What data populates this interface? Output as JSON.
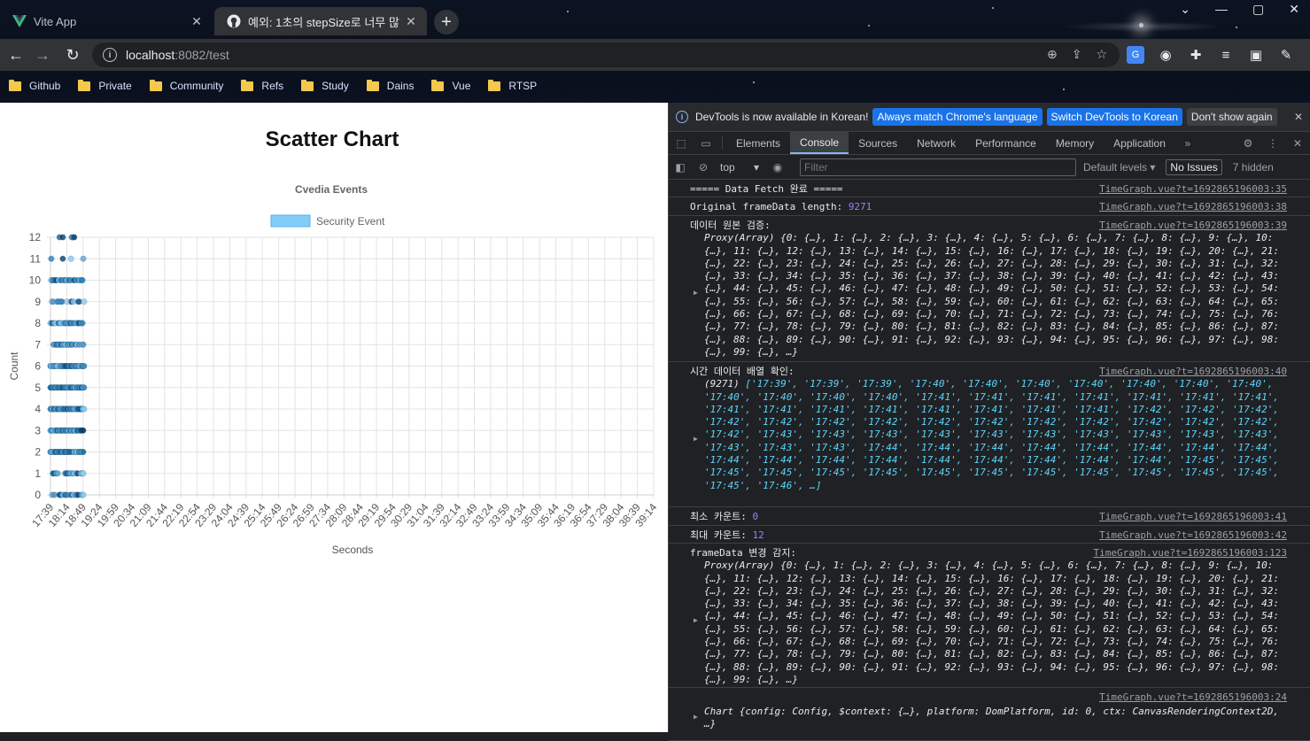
{
  "browser": {
    "tabs": [
      {
        "title": "Vite App",
        "icon": "vue-logo-icon",
        "active": false
      },
      {
        "title": "예외: 1초의 stepSize로 너무 많",
        "icon": "github-icon",
        "active": true
      }
    ],
    "new_tab": "+",
    "address": {
      "host": "localhost",
      "path": ":8082/test"
    },
    "bookmarks": [
      "Github",
      "Private",
      "Community",
      "Refs",
      "Study",
      "Dains",
      "Vue",
      "RTSP"
    ]
  },
  "page": {
    "title": "Scatter Chart"
  },
  "chart_data": {
    "type": "scatter",
    "title": "Cvedia Events",
    "xlabel": "Seconds",
    "ylabel": "Count",
    "legend": {
      "label": "Security Event",
      "color": "#82cdf7",
      "position": "top"
    },
    "ylim": [
      0,
      12
    ],
    "yticks": [
      "0",
      "1",
      "2",
      "3",
      "4",
      "5",
      "6",
      "7",
      "8",
      "9",
      "10",
      "11",
      "12"
    ],
    "xticks": [
      "17:39",
      "18:14",
      "18:49",
      "19:24",
      "19:59",
      "20:34",
      "21:09",
      "21:44",
      "22:19",
      "22:54",
      "23:29",
      "24:04",
      "24:39",
      "25:14",
      "25:49",
      "26:24",
      "26:59",
      "27:34",
      "28:09",
      "28:44",
      "29:19",
      "29:54",
      "30:29",
      "31:04",
      "31:39",
      "32:14",
      "32:49",
      "33:24",
      "33:59",
      "34:34",
      "35:09",
      "35:44",
      "36:19",
      "36:54",
      "37:29",
      "38:04",
      "38:39",
      "39:14"
    ],
    "x_range_seconds": [
      "17:39",
      "18:50"
    ],
    "series": [
      {
        "name": "Security Event",
        "y_values_present": [
          0,
          1,
          2,
          3,
          4,
          5,
          6,
          7,
          8,
          9,
          10,
          11,
          12
        ]
      }
    ],
    "grid": true
  },
  "devtools": {
    "infobar": {
      "text": "DevTools is now available in Korean!",
      "btn_match": "Always match Chrome's language",
      "btn_switch": "Switch DevTools to Korean",
      "btn_dismiss": "Don't show again"
    },
    "tabs": [
      "Elements",
      "Console",
      "Sources",
      "Network",
      "Performance",
      "Memory",
      "Application"
    ],
    "active_tab": "Console",
    "console_bar": {
      "context": "top",
      "filter_placeholder": "Filter",
      "levels": "Default levels ▾",
      "issues": "No Issues",
      "hidden": "7 hidden"
    },
    "messages": [
      {
        "text": "===== Data Fetch 완료 =====",
        "src": "TimeGraph.vue?t=1692865196003:35"
      },
      {
        "text": "Original frameData length: ",
        "num": "9271",
        "src": "TimeGraph.vue?t=1692865196003:38"
      },
      {
        "text": "데이터 원본 검증:",
        "src": "TimeGraph.vue?t=1692865196003:39",
        "obj": "Proxy(Array) {0: {…}, 1: {…}, 2: {…}, 3: {…}, 4: {…}, 5: {…}, 6: {…}, 7: {…}, 8: {…}, 9: {…}, 10: {…}, 11: {…}, 12: {…}, 13: {…}, 14: {…}, 15: {…}, 16: {…}, 17: {…}, 18: {…}, 19: {…}, 20: {…}, 21: {…}, 22: {…}, 23: {…}, 24: {…}, 25: {…}, 26: {…}, 27: {…}, 28: {…}, 29: {…}, 30: {…}, 31: {…}, 32: {…}, 33: {…}, 34: {…}, 35: {…}, 36: {…}, 37: {…}, 38: {…}, 39: {…}, 40: {…}, 41: {…}, 42: {…}, 43: {…}, 44: {…}, 45: {…}, 46: {…}, 47: {…}, 48: {…}, 49: {…}, 50: {…}, 51: {…}, 52: {…}, 53: {…}, 54: {…}, 55: {…}, 56: {…}, 57: {…}, 58: {…}, 59: {…}, 60: {…}, 61: {…}, 62: {…}, 63: {…}, 64: {…}, 65: {…}, 66: {…}, 67: {…}, 68: {…}, 69: {…}, 70: {…}, 71: {…}, 72: {…}, 73: {…}, 74: {…}, 75: {…}, 76: {…}, 77: {…}, 78: {…}, 79: {…}, 80: {…}, 81: {…}, 82: {…}, 83: {…}, 84: {…}, 85: {…}, 86: {…}, 87: {…}, 88: {…}, 89: {…}, 90: {…}, 91: {…}, 92: {…}, 93: {…}, 94: {…}, 95: {…}, 96: {…}, 97: {…}, 98: {…}, 99: {…}, …}"
      },
      {
        "text": "시간 데이터 배열 확인:",
        "src": "TimeGraph.vue?t=1692865196003:40",
        "lead": "(9271) ",
        "strs": "['17:39', '17:39', '17:39', '17:40', '17:40', '17:40', '17:40', '17:40', '17:40', '17:40', '17:40', '17:40', '17:40', '17:40', '17:41', '17:41', '17:41', '17:41', '17:41', '17:41', '17:41', '17:41', '17:41', '17:41', '17:41', '17:41', '17:41', '17:41', '17:41', '17:42', '17:42', '17:42', '17:42', '17:42', '17:42', '17:42', '17:42', '17:42', '17:42', '17:42', '17:42', '17:42', '17:42', '17:42', '17:43', '17:43', '17:43', '17:43', '17:43', '17:43', '17:43', '17:43', '17:43', '17:43', '17:43', '17:43', '17:43', '17:44', '17:44', '17:44', '17:44', '17:44', '17:44', '17:44', '17:44', '17:44', '17:44', '17:44', '17:44', '17:44', '17:44', '17:44', '17:44', '17:44', '17:45', '17:45', '17:45', '17:45', '17:45', '17:45', '17:45', '17:45', '17:45', '17:45', '17:45', '17:45', '17:45', '17:45', '17:46', …]"
      },
      {
        "text": "최소 카운트: ",
        "num": "0",
        "src": "TimeGraph.vue?t=1692865196003:41"
      },
      {
        "text": "최대 카운트: ",
        "num": "12",
        "src": "TimeGraph.vue?t=1692865196003:42"
      },
      {
        "text": "frameData 변경 감지:",
        "src": "TimeGraph.vue?t=1692865196003:123",
        "obj": "Proxy(Array) {0: {…}, 1: {…}, 2: {…}, 3: {…}, 4: {…}, 5: {…}, 6: {…}, 7: {…}, 8: {…}, 9: {…}, 10: {…}, 11: {…}, 12: {…}, 13: {…}, 14: {…}, 15: {…}, 16: {…}, 17: {…}, 18: {…}, 19: {…}, 20: {…}, 21: {…}, 22: {…}, 23: {…}, 24: {…}, 25: {…}, 26: {…}, 27: {…}, 28: {…}, 29: {…}, 30: {…}, 31: {…}, 32: {…}, 33: {…}, 34: {…}, 35: {…}, 36: {…}, 37: {…}, 38: {…}, 39: {…}, 40: {…}, 41: {…}, 42: {…}, 43: {…}, 44: {…}, 45: {…}, 46: {…}, 47: {…}, 48: {…}, 49: {…}, 50: {…}, 51: {…}, 52: {…}, 53: {…}, 54: {…}, 55: {…}, 56: {…}, 57: {…}, 58: {…}, 59: {…}, 60: {…}, 61: {…}, 62: {…}, 63: {…}, 64: {…}, 65: {…}, 66: {…}, 67: {…}, 68: {…}, 69: {…}, 70: {…}, 71: {…}, 72: {…}, 73: {…}, 74: {…}, 75: {…}, 76: {…}, 77: {…}, 78: {…}, 79: {…}, 80: {…}, 81: {…}, 82: {…}, 83: {…}, 84: {…}, 85: {…}, 86: {…}, 87: {…}, 88: {…}, 89: {…}, 90: {…}, 91: {…}, 92: {…}, 93: {…}, 94: {…}, 95: {…}, 96: {…}, 97: {…}, 98: {…}, 99: {…}, …}"
      },
      {
        "text": "",
        "src": "TimeGraph.vue?t=1692865196003:24",
        "obj": "Chart {config: Config, $context: {…}, platform: DomPlatform, id: 0, ctx: CanvasRenderingContext2D, …}"
      }
    ]
  }
}
